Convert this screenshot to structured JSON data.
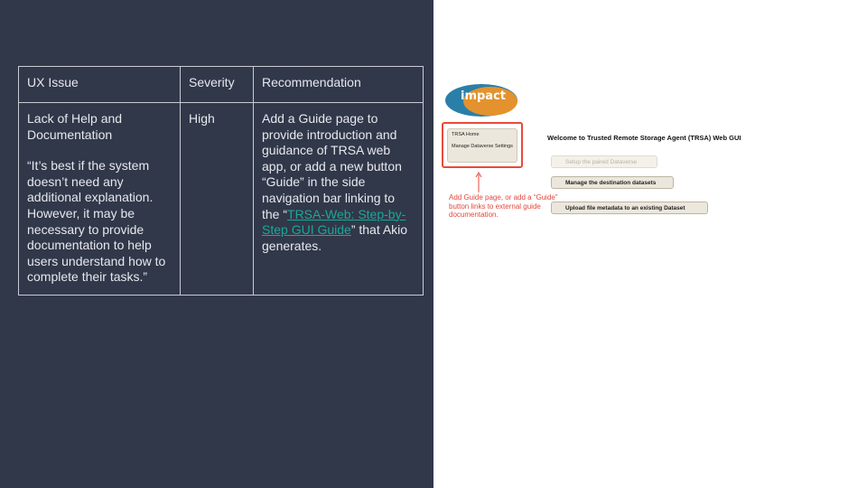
{
  "table": {
    "headers": [
      "UX Issue",
      "Severity",
      "Recommendation"
    ],
    "row": {
      "issue_title": "Lack of Help and Documentation",
      "issue_quote": "“It’s best if the system doesn’t need any additional explanation. However, it may be necessary to provide documentation to help users understand how to complete their tasks.”",
      "severity": "High",
      "recommendation_before": "Add a Guide page to provide introduction and guidance of TRSA web app, or add a new button “Guide” in the side navigation bar linking to the “",
      "recommendation_link": "TRSA-Web: Step-by-Step GUI Guide",
      "recommendation_after": "” that Akio generates."
    }
  },
  "screenshot": {
    "logo_text": "impact",
    "logo_colors": {
      "left": "#2a7fa8",
      "right": "#e3922e"
    },
    "sidebar": {
      "items": [
        "TRSA Home",
        "Manage Dataverse Settings"
      ]
    },
    "annotation": "Add Guide page, or add a “Guide” button links to external guide documentation.",
    "welcome_title": "Welcome to Trusted Remote Storage Agent (TRSA) Web GUI",
    "buttons": [
      "Setup the paired Dataverse",
      "Manage the destination datasets",
      "Upload file metadata to an existing Dataset"
    ]
  },
  "colors": {
    "left_background": "#313849",
    "link": "#1aa89a",
    "annotation_red": "#e84a3a"
  }
}
